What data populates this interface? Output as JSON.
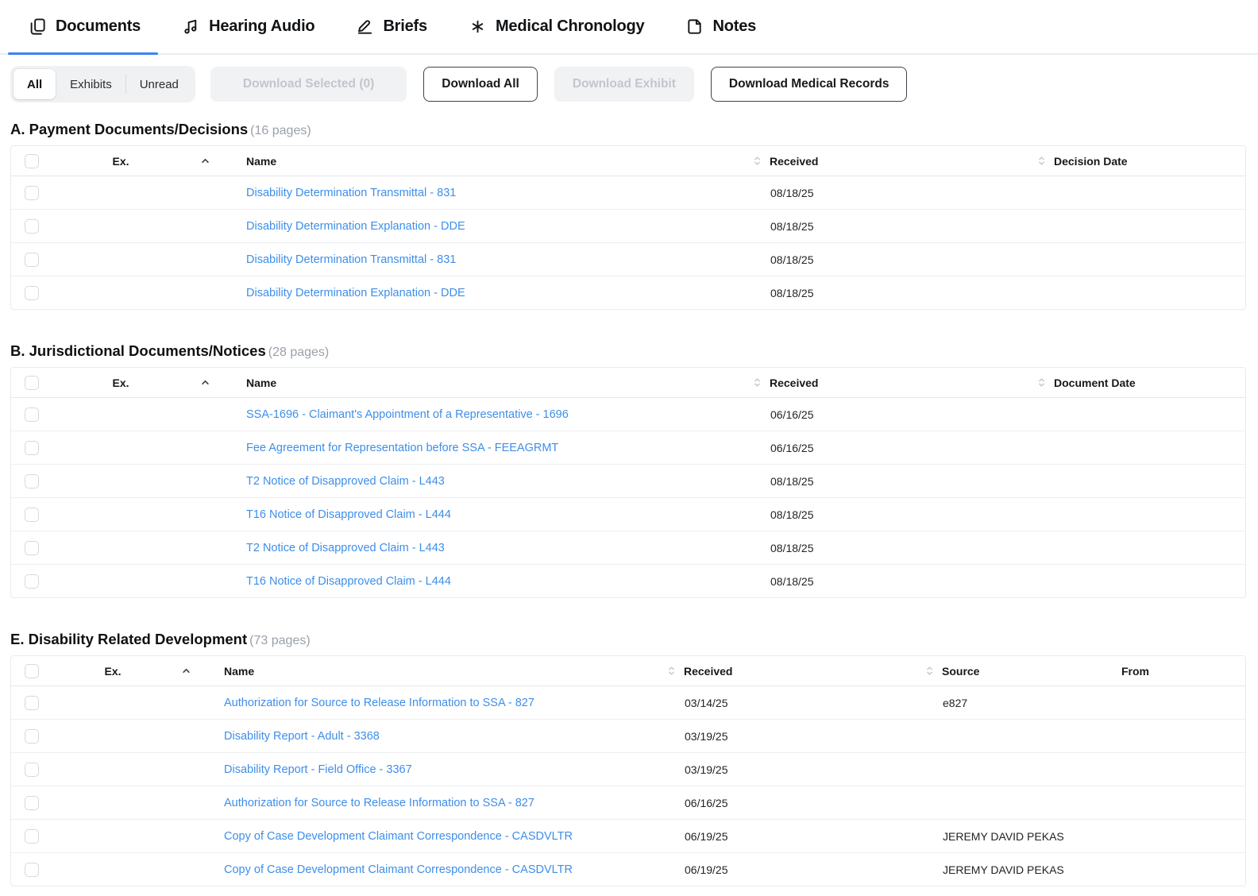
{
  "colors": {
    "accent": "#3b82f6",
    "link": "#3e8ee9"
  },
  "tabs": {
    "items": [
      {
        "label": "Documents",
        "icon": "documents-icon",
        "active": true
      },
      {
        "label": "Hearing Audio",
        "icon": "hearing-audio-icon",
        "active": false
      },
      {
        "label": "Briefs",
        "icon": "briefs-icon",
        "active": false
      },
      {
        "label": "Medical Chronology",
        "icon": "medical-chronology-icon",
        "active": false
      },
      {
        "label": "Notes",
        "icon": "notes-icon",
        "active": false
      }
    ]
  },
  "filters": {
    "options": [
      "All",
      "Exhibits",
      "Unread"
    ],
    "selected": "All"
  },
  "toolbar": {
    "buttons": [
      {
        "label": "Download Selected (0)",
        "enabled": false
      },
      {
        "label": "Download All",
        "enabled": true
      },
      {
        "label": "Download Exhibit",
        "enabled": false
      },
      {
        "label": "Download Medical Records",
        "enabled": true
      }
    ]
  },
  "sections": [
    {
      "title": "A. Payment Documents/Decisions",
      "pages": "(16 pages)",
      "columns": [
        {
          "label": "Ex.",
          "sort": "asc"
        },
        {
          "label": "Name",
          "sort": "none"
        },
        {
          "label": "Received",
          "sort": "both"
        },
        {
          "label": "Decision Date",
          "sort": "both"
        }
      ],
      "rows": [
        {
          "ex": "",
          "name": "Disability Determination Transmittal - 831",
          "cells": [
            "08/18/25",
            ""
          ]
        },
        {
          "ex": "",
          "name": "Disability Determination Explanation - DDE",
          "cells": [
            "08/18/25",
            ""
          ]
        },
        {
          "ex": "",
          "name": "Disability Determination Transmittal - 831",
          "cells": [
            "08/18/25",
            ""
          ]
        },
        {
          "ex": "",
          "name": "Disability Determination Explanation - DDE",
          "cells": [
            "08/18/25",
            ""
          ]
        }
      ]
    },
    {
      "title": "B. Jurisdictional Documents/Notices",
      "pages": "(28 pages)",
      "columns": [
        {
          "label": "Ex.",
          "sort": "asc"
        },
        {
          "label": "Name",
          "sort": "none"
        },
        {
          "label": "Received",
          "sort": "both"
        },
        {
          "label": "Document Date",
          "sort": "both"
        }
      ],
      "rows": [
        {
          "ex": "",
          "name": "SSA-1696 - Claimant's Appointment of a Representative - 1696",
          "cells": [
            "06/16/25",
            ""
          ]
        },
        {
          "ex": "",
          "name": "Fee Agreement for Representation before SSA - FEEAGRMT",
          "cells": [
            "06/16/25",
            ""
          ]
        },
        {
          "ex": "",
          "name": "T2 Notice of Disapproved Claim - L443",
          "cells": [
            "08/18/25",
            ""
          ]
        },
        {
          "ex": "",
          "name": "T16 Notice of Disapproved Claim - L444",
          "cells": [
            "08/18/25",
            ""
          ]
        },
        {
          "ex": "",
          "name": "T2 Notice of Disapproved Claim - L443",
          "cells": [
            "08/18/25",
            ""
          ]
        },
        {
          "ex": "",
          "name": "T16 Notice of Disapproved Claim - L444",
          "cells": [
            "08/18/25",
            ""
          ]
        }
      ]
    },
    {
      "title": "E. Disability Related Development",
      "pages": "(73 pages)",
      "columns": [
        {
          "label": "Ex.",
          "sort": "asc"
        },
        {
          "label": "Name",
          "sort": "none"
        },
        {
          "label": "Received",
          "sort": "both"
        },
        {
          "label": "Source",
          "sort": "both"
        },
        {
          "label": "From",
          "sort": "none"
        }
      ],
      "rows": [
        {
          "ex": "",
          "name": "Authorization for Source to Release Information to SSA - 827",
          "cells": [
            "03/14/25",
            "e827",
            ""
          ]
        },
        {
          "ex": "",
          "name": "Disability Report - Adult - 3368",
          "cells": [
            "03/19/25",
            "",
            ""
          ]
        },
        {
          "ex": "",
          "name": "Disability Report - Field Office - 3367",
          "cells": [
            "03/19/25",
            "",
            ""
          ]
        },
        {
          "ex": "",
          "name": "Authorization for Source to Release Information to SSA - 827",
          "cells": [
            "06/16/25",
            "",
            ""
          ]
        },
        {
          "ex": "",
          "name": "Copy of Case Development Claimant Correspondence - CASDVLTR",
          "cells": [
            "06/19/25",
            "JEREMY DAVID PEKAS",
            ""
          ]
        },
        {
          "ex": "",
          "name": "Copy of Case Development Claimant Correspondence - CASDVLTR",
          "cells": [
            "06/19/25",
            "JEREMY DAVID PEKAS",
            ""
          ]
        }
      ]
    }
  ]
}
